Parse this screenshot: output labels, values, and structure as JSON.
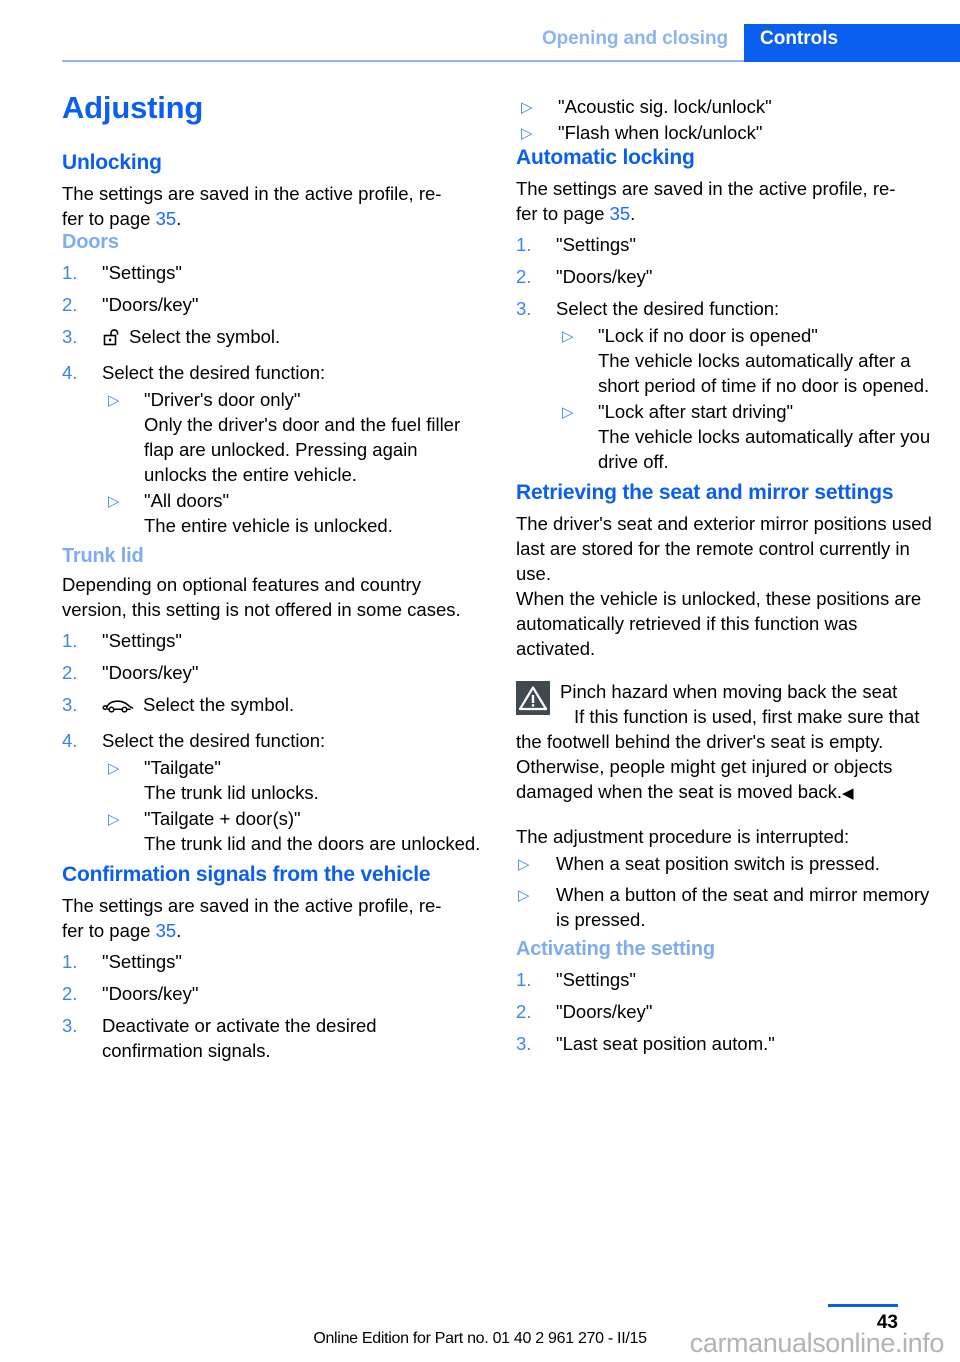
{
  "header": {
    "tab_inactive": "Opening and closing",
    "tab_active": "Controls",
    "accent_blue": "#0B5FEF",
    "light_blue": "#8CB4F0"
  },
  "left": {
    "title": "Adjusting",
    "unlocking": {
      "heading": "Unlocking",
      "intro_a": "The settings are saved in the active profile, re-",
      "intro_b": "fer to page ",
      "page_ref": "35",
      "intro_c": "."
    },
    "doors": {
      "heading": "Doors",
      "steps": [
        {
          "num": "1.",
          "text": "\"Settings\""
        },
        {
          "num": "2.",
          "text": "\"Doors/key\""
        },
        {
          "num": "3.",
          "text": "Select the symbol.",
          "icon": "padlock-open-icon"
        },
        {
          "num": "4.",
          "text": "Select the desired function:"
        }
      ],
      "options": [
        {
          "label": "\"Driver's door only\"",
          "description": "Only the driver's door and the fuel filler flap are unlocked. Pressing again unlocks the entire vehicle."
        },
        {
          "label": "\"All doors\"",
          "description": "The entire vehicle is unlocked."
        }
      ]
    },
    "trunk": {
      "heading": "Trunk lid",
      "intro": "Depending on optional features and country version, this setting is not offered in some cases.",
      "steps": [
        {
          "num": "1.",
          "text": "\"Settings\""
        },
        {
          "num": "2.",
          "text": "\"Doors/key\""
        },
        {
          "num": "3.",
          "text": "Select the symbol.",
          "icon": "car-trunk-open-icon"
        },
        {
          "num": "4.",
          "text": "Select the desired function:"
        }
      ],
      "options": [
        {
          "label": "\"Tailgate\"",
          "description": "The trunk lid unlocks."
        },
        {
          "label": "\"Tailgate + door(s)\"",
          "description": "The trunk lid and the doors are unlocked."
        }
      ]
    },
    "confirmation": {
      "heading": "Confirmation signals from the vehicle",
      "intro_a": "The settings are saved in the active profile, re-",
      "intro_b": "fer to page ",
      "page_ref": "35",
      "intro_c": ".",
      "steps": [
        {
          "num": "1.",
          "text": "\"Settings\""
        },
        {
          "num": "2.",
          "text": "\"Doors/key\""
        },
        {
          "num": "3.",
          "text": "Deactivate or activate the desired confirmation signals."
        }
      ]
    }
  },
  "right": {
    "confirmation_options": [
      "\"Acoustic sig. lock/unlock\"",
      "\"Flash when lock/unlock\""
    ],
    "automatic_locking": {
      "heading": "Automatic locking",
      "intro_a": "The settings are saved in the active profile, re-",
      "intro_b": "fer to page ",
      "page_ref": "35",
      "intro_c": ".",
      "steps": [
        {
          "num": "1.",
          "text": "\"Settings\""
        },
        {
          "num": "2.",
          "text": "\"Doors/key\""
        },
        {
          "num": "3.",
          "text": "Select the desired function:"
        }
      ],
      "options": [
        {
          "label": "\"Lock if no door is opened\"",
          "description": "The vehicle locks automatically after a short period of time if no door is opened."
        },
        {
          "label": "\"Lock after start driving\"",
          "description": "The vehicle locks automatically after you drive off."
        }
      ]
    },
    "retrieving": {
      "heading": "Retrieving the seat and mirror settings",
      "para1": "The driver's seat and exterior mirror positions used last are stored for the remote control currently in use.",
      "para2": "When the vehicle is unlocked, these positions are automatically retrieved if this function was activated.",
      "warning": {
        "icon": "warning-triangle-icon",
        "title": "Pinch hazard when moving back the seat",
        "body": "If this function is used, first make sure that the footwell behind the driver's seat is empty. Otherwise, people might get injured or objects damaged when the seat is moved back.",
        "end_mark": "◀",
        "icon_bg": "#3E4A4F"
      },
      "para3": "The adjustment procedure is interrupted:",
      "bullets": [
        "When a seat position switch is pressed.",
        "When a button of the seat and mirror memory is pressed."
      ]
    },
    "activating": {
      "heading": "Activating the setting",
      "steps": [
        {
          "num": "1.",
          "text": "\"Settings\""
        },
        {
          "num": "2.",
          "text": "\"Doors/key\""
        },
        {
          "num": "3.",
          "text": "\"Last seat position autom.\""
        }
      ]
    }
  },
  "footer": {
    "page_number": "43",
    "edition": "Online Edition for Part no. 01 40 2 961 270 - II/15",
    "watermark": "carmanualsonline.info"
  }
}
